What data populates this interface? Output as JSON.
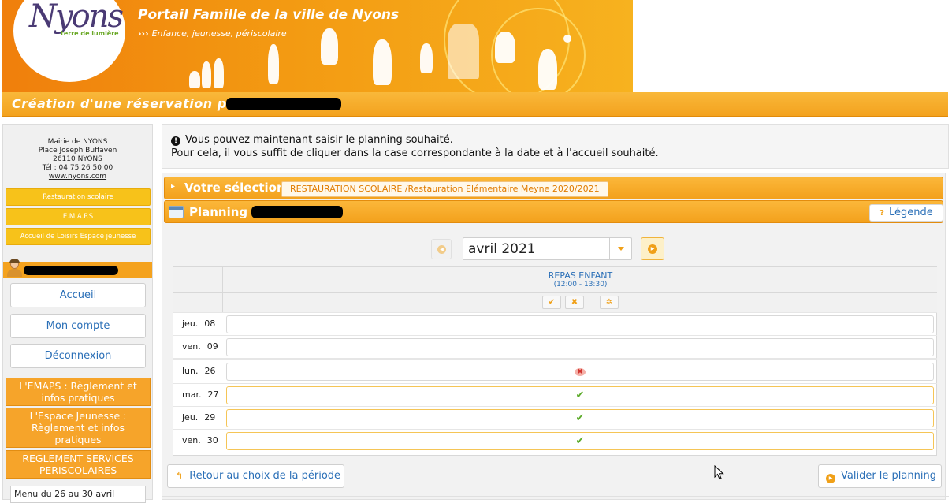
{
  "banner": {
    "logo_text": "Nyons",
    "logo_sub": "terre de lumière",
    "title": "Portail Famille de la ville de Nyons",
    "subtitle": "Enfance, jeunesse, périscolaire",
    "subtitle_arrows": "›››"
  },
  "page_title": "Création d'une réservation pour",
  "sidebar": {
    "address": {
      "line1": "Mairie de NYONS",
      "line2": "Place Joseph Buffaven",
      "line3": "26110 NYONS",
      "phone": "Tél : 04 75 26 50 00",
      "website": "www.nyons.com"
    },
    "services": [
      {
        "label": "Restauration scolaire"
      },
      {
        "label": "E.M.A.P.S"
      },
      {
        "label": "Accueil de Loisirs Espace jeunesse"
      }
    ],
    "nav": [
      {
        "label": "Accueil"
      },
      {
        "label": "Mon compte"
      },
      {
        "label": "Déconnexion"
      }
    ],
    "docs": [
      {
        "label": "L'EMAPS : Règlement et infos pratiques"
      },
      {
        "label": "L'Espace Jeunesse : Règlement et infos pratiques"
      },
      {
        "label": "REGLEMENT SERVICES PERISCOLAIRES"
      }
    ],
    "menu_label": "Menu du 26 au 30 avril"
  },
  "info": {
    "line1": "Vous pouvez maintenant saisir le planning souhaité.",
    "line2": "Pour cela, il vous suffit de cliquer dans la case correspondante à la date et à l'accueil souhaité."
  },
  "selection": {
    "label": "Votre sélection",
    "value": "RESTAURATION SCOLAIRE /Restauration Elémentaire Meyne 2020/2021"
  },
  "planning": {
    "label": "Planning -",
    "legend_label": "Légende",
    "month": "avril 2021",
    "column_title": "REPAS ENFANT",
    "column_hours": "(12:00 - 13:30)",
    "actions": {
      "check": "✔",
      "cross": "✖",
      "gear": "✲"
    },
    "rows": [
      {
        "day": "jeu.",
        "num": "08",
        "status": ""
      },
      {
        "day": "ven.",
        "num": "09",
        "status": ""
      },
      {
        "day": "lun.",
        "num": "26",
        "status": "✖"
      },
      {
        "day": "mar.",
        "num": "27",
        "status": "✔"
      },
      {
        "day": "jeu.",
        "num": "29",
        "status": "✔"
      },
      {
        "day": "ven.",
        "num": "30",
        "status": "✔"
      }
    ]
  },
  "buttons": {
    "back": "Retour au choix de la période",
    "validate": "Valider le planning"
  },
  "colors": {
    "accent_orange": "#f3a11c",
    "link_blue": "#2a6fb7",
    "check_green": "#5cab2a"
  }
}
